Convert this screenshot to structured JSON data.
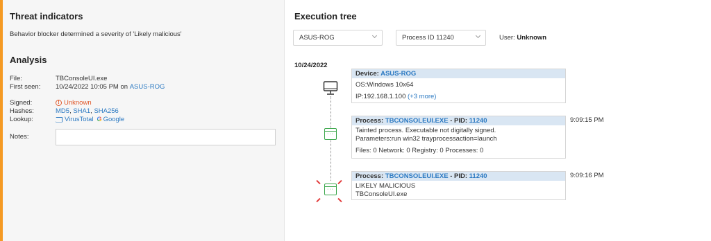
{
  "threat": {
    "title": "Threat indicators",
    "description": "Behavior blocker determined a severity of 'Likely malicious'"
  },
  "analysis": {
    "title": "Analysis",
    "file_label": "File:",
    "file_value": "TBConsoleUI.exe",
    "first_seen_label": "First seen:",
    "first_seen_value": "10/24/2022 10:05 PM on",
    "first_seen_device": "ASUS-ROG",
    "signed_label": "Signed:",
    "signed_value": "Unknown",
    "hashes_label": "Hashes:",
    "hashes": [
      "MD5",
      "SHA1",
      "SHA256"
    ],
    "lookup_label": "Lookup:",
    "lookup_virustotal": "VirusTotal",
    "lookup_google": "Google",
    "notes_label": "Notes:",
    "notes_value": ""
  },
  "execution": {
    "title": "Execution tree",
    "device_select": "ASUS-ROG",
    "process_select": "Process ID 11240",
    "user_label": "User:",
    "user_value": "Unknown",
    "date": "10/24/2022",
    "device_card": {
      "head_label": "Device:",
      "head_value": "ASUS-ROG",
      "os": "OS:Windows 10x64",
      "ip": "IP:192.168.1.100",
      "ip_more": "(+3 more)"
    },
    "process_card_1": {
      "head_label": "Process:",
      "process_name": "TBCONSOLEUI.EXE",
      "pid_label": "- PID:",
      "pid": "11240",
      "line1": "Tainted process. Executable not digitally signed.",
      "line2": "Parameters:run win32 trayprocessaction=launch",
      "line3": "Files: 0 Network: 0 Registry: 0 Processes: 0",
      "time": "9:09:15 PM"
    },
    "process_card_2": {
      "head_label": "Process:",
      "process_name": "TBCONSOLEUI.EXE",
      "pid_label": "- PID:",
      "pid": "11240",
      "line1": "LIKELY MALICIOUS",
      "line2": "TBConsoleUI.exe",
      "time": "9:09:16 PM"
    }
  },
  "colors": {
    "accent": "#f59a23",
    "link": "#2b79c2",
    "warning": "#e0582a",
    "process_node": "#3aa64a",
    "alert": "#e23b3b",
    "card_header": "#d9e6f3"
  }
}
